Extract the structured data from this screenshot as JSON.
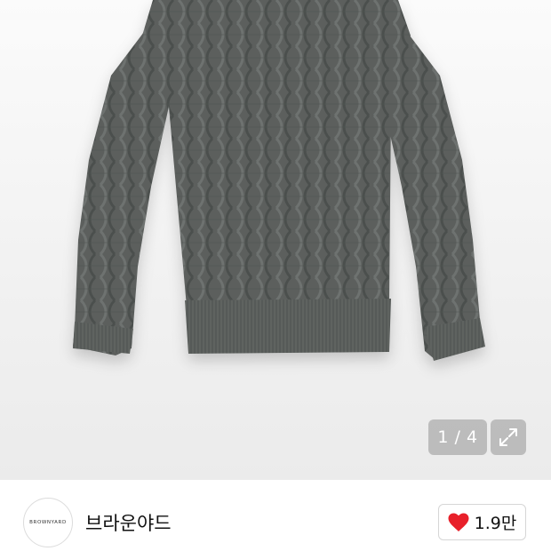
{
  "gallery": {
    "page_indicator": "1 / 4",
    "expand_icon": "expand-arrows-icon"
  },
  "brand": {
    "logo_text": "BROWNYARD",
    "name": "브라운야드"
  },
  "like": {
    "icon": "heart-icon",
    "color": "#e8202a",
    "count": "1.9만"
  },
  "colors": {
    "sweater": "#5a5e5c",
    "background": "#f2f2f2"
  }
}
